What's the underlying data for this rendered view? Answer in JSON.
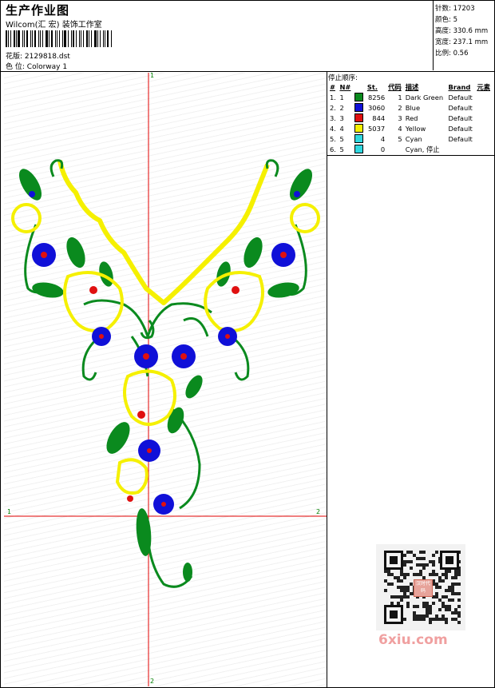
{
  "header": {
    "title": "生产作业图",
    "subtitle": "Wilcom(汇 宏) 装饰工作室",
    "design_label": "花版:",
    "design_file": "2129818.dst",
    "color_label": "色 位:",
    "colorway": "Colorway 1"
  },
  "stats": {
    "stitches": "针数: 17203",
    "colors": "颜色: 5",
    "height": "高度: 330.6 mm",
    "width": "宽度: 237.1 mm",
    "ratio": "比例: 0.56"
  },
  "stop_sequence": {
    "title": "停止顺序:",
    "columns": [
      "#",
      "N#",
      "St.",
      "代码",
      "描述",
      "Brand",
      "元素"
    ],
    "rows": [
      {
        "num": "1.",
        "n": "1",
        "swatch": "#0a8a1e",
        "st": "8256",
        "code": "1",
        "desc": "Dark Green",
        "brand": "Default"
      },
      {
        "num": "2.",
        "n": "2",
        "swatch": "#1010d8",
        "st": "3060",
        "code": "2",
        "desc": "Blue",
        "brand": "Default"
      },
      {
        "num": "3.",
        "n": "3",
        "swatch": "#e01010",
        "st": "844",
        "code": "3",
        "desc": "Red",
        "brand": "Default"
      },
      {
        "num": "4.",
        "n": "4",
        "swatch": "#f5f000",
        "st": "5037",
        "code": "4",
        "desc": "Yellow",
        "brand": "Default"
      },
      {
        "num": "5.",
        "n": "5",
        "swatch": "#30d8e0",
        "st": "4",
        "code": "5",
        "desc": "Cyan",
        "brand": "Default"
      },
      {
        "num": "6.",
        "n": "5",
        "swatch": "#30d8e0",
        "st": "0",
        "code": "",
        "desc": "Cyan, 停止",
        "brand": ""
      }
    ]
  },
  "canvas_marks": {
    "top": "1",
    "left": "1",
    "right": "2",
    "bottom": "2"
  },
  "watermark": "6xiu.com",
  "qr_logo_text": "汉时代码"
}
